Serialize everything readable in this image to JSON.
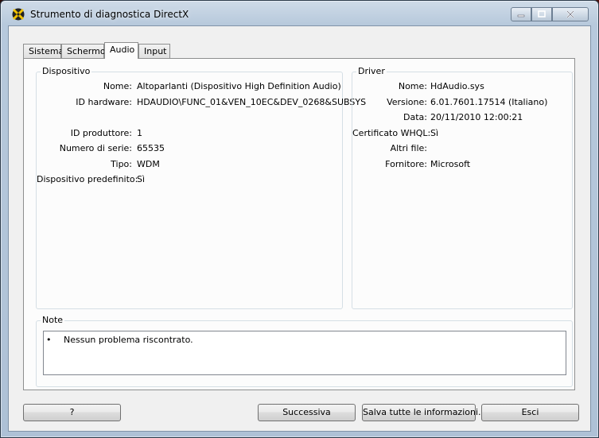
{
  "window": {
    "title": "Strumento di diagnostica DirectX"
  },
  "tabs": [
    {
      "label": "Sistema",
      "active": false
    },
    {
      "label": "Schermo",
      "active": false
    },
    {
      "label": "Audio",
      "active": true
    },
    {
      "label": "Input",
      "active": false
    }
  ],
  "device": {
    "group_label": "Dispositivo",
    "fields": [
      {
        "label": "Nome:",
        "value": "Altoparlanti (Dispositivo High Definition Audio)"
      },
      {
        "label": "ID hardware:",
        "value": "HDAUDIO\\FUNC_01&VEN_10EC&DEV_0268&SUBSYS"
      },
      {
        "label": "ID produttore:",
        "value": "1"
      },
      {
        "label": "Numero di serie:",
        "value": "65535"
      },
      {
        "label": "Tipo:",
        "value": "WDM"
      },
      {
        "label": "Dispositivo predefinito:",
        "value": "Sì"
      }
    ]
  },
  "driver": {
    "group_label": "Driver",
    "fields": [
      {
        "label": "Nome:",
        "value": "HdAudio.sys"
      },
      {
        "label": "Versione:",
        "value": "6.01.7601.17514 (Italiano)"
      },
      {
        "label": "Data:",
        "value": "20/11/2010 12:00:21"
      },
      {
        "label": "Certificato WHQL:",
        "value": "Sì"
      },
      {
        "label": "Altri file:",
        "value": ""
      },
      {
        "label": "Fornitore:",
        "value": "Microsoft"
      }
    ]
  },
  "notes": {
    "group_label": "Note",
    "bullet": "•",
    "items": [
      "Nessun problema riscontrato."
    ]
  },
  "buttons": {
    "help": "?",
    "next": "Successiva",
    "save_all": "Salva tutte le informazioni...",
    "exit": "Esci"
  },
  "icons": {
    "app": "directx-icon",
    "minimize": "minimize-icon",
    "maximize": "maximize-icon",
    "close": "close-icon"
  }
}
